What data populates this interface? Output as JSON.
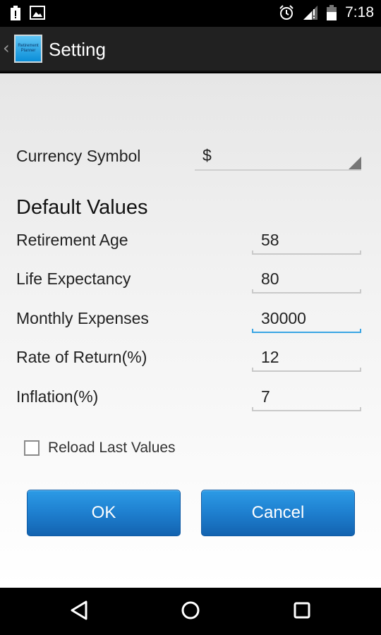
{
  "status_bar": {
    "time": "7:18",
    "icons": [
      "notification-battery-icon",
      "image-icon",
      "alarm-icon",
      "signal-icon",
      "battery-icon"
    ]
  },
  "action_bar": {
    "app_icon_text": "Retirement Planner",
    "title": "Setting"
  },
  "settings": {
    "currency_label": "Currency Symbol",
    "currency_value": "$",
    "section_title": "Default Values",
    "fields": [
      {
        "label": "Retirement Age",
        "value": "58"
      },
      {
        "label": "Life Expectancy",
        "value": "80"
      },
      {
        "label": "Monthly Expenses",
        "value": "30000"
      },
      {
        "label": "Rate of Return(%)",
        "value": "12"
      },
      {
        "label": "Inflation(%)",
        "value": "7"
      }
    ],
    "reload_label": "Reload Last Values",
    "reload_checked": false
  },
  "buttons": {
    "ok": "OK",
    "cancel": "Cancel"
  },
  "colors": {
    "accent": "#1e7fcf",
    "focus_underline": "#3aa5e4",
    "action_bar": "#212121"
  }
}
